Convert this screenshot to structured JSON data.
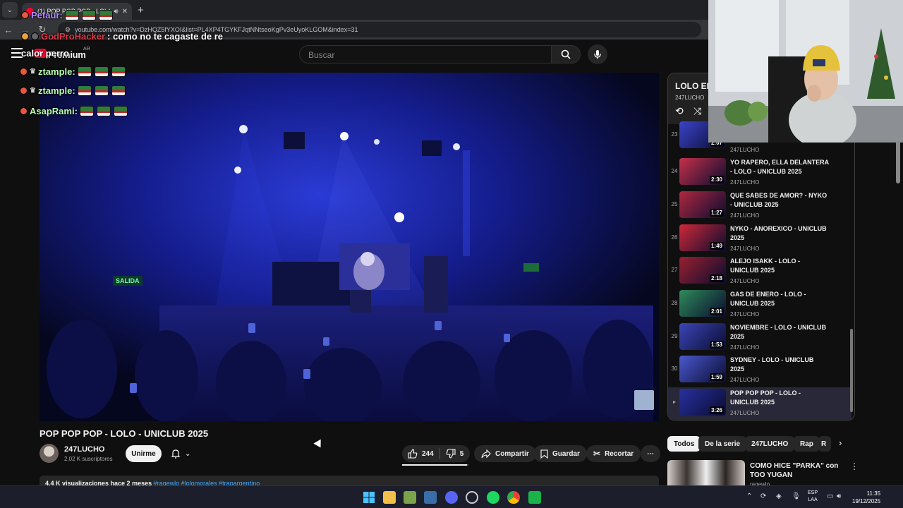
{
  "browser": {
    "tab_title": "(1) POP POP POP - LOLO",
    "url": "youtube.com/watch?v=DzHQZ5fYXOI&list=PL4XP4TGYKFJqtNNtseoKgPv3eUyoKLGOM&index=31",
    "new_tab": "+"
  },
  "youtube": {
    "brand": "Premium",
    "country": "AR",
    "search_placeholder": "Buscar"
  },
  "chat": [
    {
      "user": "Pefaur:",
      "message": "",
      "color": "purple"
    },
    {
      "user": "GodProHacker",
      "message": ": como no te cagaste de re",
      "color": "red"
    },
    {
      "user": "calor perro",
      "message": "",
      "color": "white"
    },
    {
      "user": "ztample:",
      "message": "",
      "color": "green"
    },
    {
      "user": "ztample:",
      "message": "",
      "color": "green"
    },
    {
      "user": "AsapRami:",
      "message": "",
      "color": "green"
    }
  ],
  "video": {
    "exit_sign": "SALIDA",
    "title": "POP POP POP - LOLO - UNICLUB 2025",
    "channel": "247LUCHO",
    "subscribers": "2,02 K suscriptores",
    "join_label": "Unirme",
    "likes": "244",
    "dislikes": "5",
    "like_ratio": 0.98,
    "share_label": "Compartir",
    "save_label": "Guardar",
    "clip_label": "Recortar",
    "views": "4,4 K visualizaciones  hace 2 meses",
    "tags": "#ragewlo  #lolomorales  #traparqentino"
  },
  "playlist": {
    "title": "LOLO EN",
    "owner": "247LUCHO",
    "items": [
      {
        "index": "23",
        "title": "",
        "channel": "247LUCHO",
        "duration": "2:07"
      },
      {
        "index": "24",
        "title": "YO RAPERO, ELLA DELANTERA - LOLO - UNICLUB 2025",
        "channel": "247LUCHO",
        "duration": "2:30"
      },
      {
        "index": "25",
        "title": "QUE SABES DE AMOR? - NYKO - UNICLUB 2025",
        "channel": "247LUCHO",
        "duration": "1:27"
      },
      {
        "index": "26",
        "title": "NYKO - ANOREXICO - UNICLUB 2025",
        "channel": "247LUCHO",
        "duration": "1:49"
      },
      {
        "index": "27",
        "title": "ALEJO ISAKK - LOLO - UNICLUB 2025",
        "channel": "247LUCHO",
        "duration": "2:18"
      },
      {
        "index": "28",
        "title": "GAS DE ENERO - LOLO - UNICLUB 2025",
        "channel": "247LUCHO",
        "duration": "2:01"
      },
      {
        "index": "29",
        "title": "NOVIEMBRE - LOLO - UNICLUB 2025",
        "channel": "247LUCHO",
        "duration": "1:53"
      },
      {
        "index": "30",
        "title": "SYDNEY - LOLO - UNICLUB 2025",
        "channel": "247LUCHO",
        "duration": "1:59"
      },
      {
        "index": "▸",
        "title": "POP POP POP - LOLO - UNICLUB 2025",
        "channel": "247LUCHO",
        "duration": "3:26"
      }
    ]
  },
  "chips": [
    "Todos",
    "De la serie",
    "247LUCHO",
    "Rap",
    "R"
  ],
  "related": {
    "title": "COMO HICE \"PARKA\" con TOO YUGAN",
    "channel": "ragewlo"
  },
  "taskbar": {
    "lang_top": "ESP",
    "lang_bottom": "LAA",
    "time": "11:35",
    "date": "19/12/2025"
  }
}
